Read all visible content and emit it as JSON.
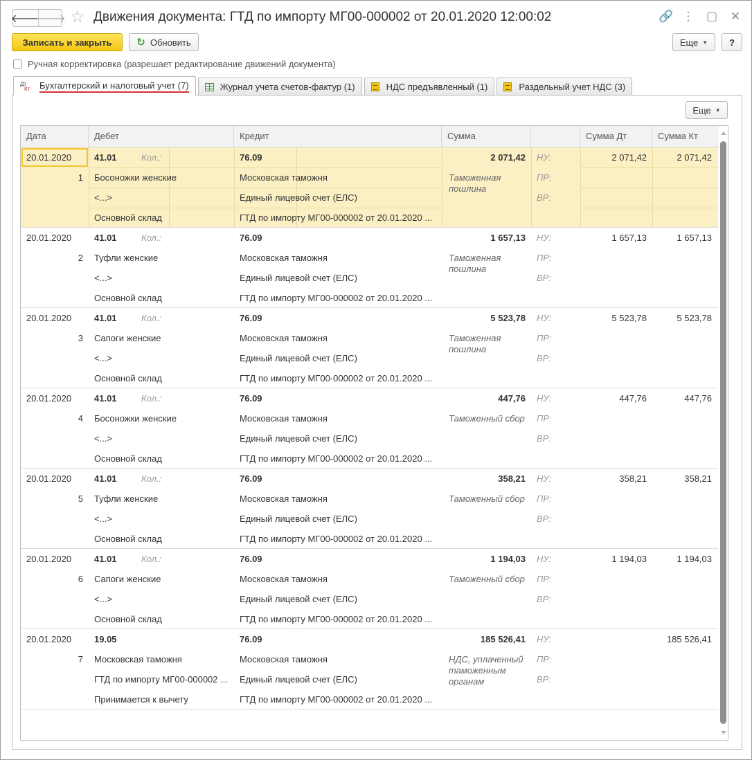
{
  "window": {
    "title": "Движения документа: ГТД по импорту МГ00-000002 от 20.01.2020 12:00:02",
    "back_glyph": "🡐",
    "forward_glyph": "🡒",
    "star_glyph": "☆",
    "link_glyph": "🔗",
    "menu_glyph": "⋮",
    "restore_glyph": "▢",
    "close_glyph": "✕",
    "icons": [
      "back-arrow-icon",
      "forward-arrow-icon",
      "star-icon",
      "link-icon",
      "more-vertical-icon",
      "restore-icon",
      "close-icon"
    ]
  },
  "toolbar": {
    "save_close_label": "Записать и закрыть",
    "refresh_label": "Обновить",
    "refresh_glyph": "↻",
    "more_label": "Еще",
    "help_label": "?"
  },
  "manual_edit": {
    "label": "Ручная корректировка (разрешает редактирование движений документа)",
    "checked": false
  },
  "tabs": [
    {
      "label": "Бухгалтерский и налоговый учет (7)",
      "icon": "dt-kt-icon",
      "active": true,
      "icon_top": "Дт",
      "icon_bottom": "Кт"
    },
    {
      "label": "Журнал учета счетов-фактур (1)",
      "icon": "table-grid-icon",
      "active": false
    },
    {
      "label": "НДС предъявленный (1)",
      "icon": "register-doc-icon",
      "active": false
    },
    {
      "label": "Раздельный учет НДС (3)",
      "icon": "register-doc-icon",
      "active": false
    }
  ],
  "panel": {
    "more_label": "Еще"
  },
  "grid": {
    "columns": [
      "Дата",
      "Дебет",
      "Кредит",
      "Сумма",
      "",
      "Сумма Дт",
      "Сумма Кт"
    ],
    "qty_label": "Кол.:",
    "nu_label": "НУ:",
    "pr_label": "ПР:",
    "vr_label": "ВР:",
    "entries": [
      {
        "date": "20.01.2020",
        "num": "1",
        "debit": "41.01",
        "debit_sub": [
          "Босоножки женские",
          "<...>",
          "Основной склад"
        ],
        "credit": "76.09",
        "credit_sub": [
          "Московская таможня",
          "Единый лицевой счет (ЕЛС)",
          "ГТД по импорту МГ00-000002 от 20.01.2020 ..."
        ],
        "amount": "2 071,42",
        "content": "Таможенная пошлина",
        "sum_dt": "2 071,42",
        "sum_kt": "2 071,42",
        "has_qty": true
      },
      {
        "date": "20.01.2020",
        "num": "2",
        "debit": "41.01",
        "debit_sub": [
          "Туфли женские",
          "<...>",
          "Основной склад"
        ],
        "credit": "76.09",
        "credit_sub": [
          "Московская таможня",
          "Единый лицевой счет (ЕЛС)",
          "ГТД по импорту МГ00-000002 от 20.01.2020 ..."
        ],
        "amount": "1 657,13",
        "content": "Таможенная пошлина",
        "sum_dt": "1 657,13",
        "sum_kt": "1 657,13",
        "has_qty": true
      },
      {
        "date": "20.01.2020",
        "num": "3",
        "debit": "41.01",
        "debit_sub": [
          "Сапоги женские",
          "<...>",
          "Основной склад"
        ],
        "credit": "76.09",
        "credit_sub": [
          "Московская таможня",
          "Единый лицевой счет (ЕЛС)",
          "ГТД по импорту МГ00-000002 от 20.01.2020 ..."
        ],
        "amount": "5 523,78",
        "content": "Таможенная пошлина",
        "sum_dt": "5 523,78",
        "sum_kt": "5 523,78",
        "has_qty": true
      },
      {
        "date": "20.01.2020",
        "num": "4",
        "debit": "41.01",
        "debit_sub": [
          "Босоножки женские",
          "<...>",
          "Основной склад"
        ],
        "credit": "76.09",
        "credit_sub": [
          "Московская таможня",
          "Единый лицевой счет (ЕЛС)",
          "ГТД по импорту МГ00-000002 от 20.01.2020 ..."
        ],
        "amount": "447,76",
        "content": "Таможенный сбор",
        "sum_dt": "447,76",
        "sum_kt": "447,76",
        "has_qty": true
      },
      {
        "date": "20.01.2020",
        "num": "5",
        "debit": "41.01",
        "debit_sub": [
          "Туфли женские",
          "<...>",
          "Основной склад"
        ],
        "credit": "76.09",
        "credit_sub": [
          "Московская таможня",
          "Единый лицевой счет (ЕЛС)",
          "ГТД по импорту МГ00-000002 от 20.01.2020 ..."
        ],
        "amount": "358,21",
        "content": "Таможенный сбор",
        "sum_dt": "358,21",
        "sum_kt": "358,21",
        "has_qty": true
      },
      {
        "date": "20.01.2020",
        "num": "6",
        "debit": "41.01",
        "debit_sub": [
          "Сапоги женские",
          "<...>",
          "Основной склад"
        ],
        "credit": "76.09",
        "credit_sub": [
          "Московская таможня",
          "Единый лицевой счет (ЕЛС)",
          "ГТД по импорту МГ00-000002 от 20.01.2020 ..."
        ],
        "amount": "1 194,03",
        "content": "Таможенный сбор",
        "sum_dt": "1 194,03",
        "sum_kt": "1 194,03",
        "has_qty": true
      },
      {
        "date": "20.01.2020",
        "num": "7",
        "debit": "19.05",
        "debit_sub": [
          "Московская таможня",
          "ГТД по импорту МГ00-000002 ...",
          "Принимается к вычету"
        ],
        "credit": "76.09",
        "credit_sub": [
          "Московская таможня",
          "Единый лицевой счет (ЕЛС)",
          "ГТД по импорту МГ00-000002 от 20.01.2020 ..."
        ],
        "amount": "185 526,41",
        "content": "НДС, уплаченный таможенным органам",
        "sum_dt": "",
        "sum_kt": "185 526,41",
        "has_qty": false
      }
    ]
  },
  "colors": {
    "primary_button": "#f4c714",
    "selected_row": "#fbefc4",
    "active_tab_underline": "#d23030",
    "refresh_icon": "#3aa53a"
  }
}
